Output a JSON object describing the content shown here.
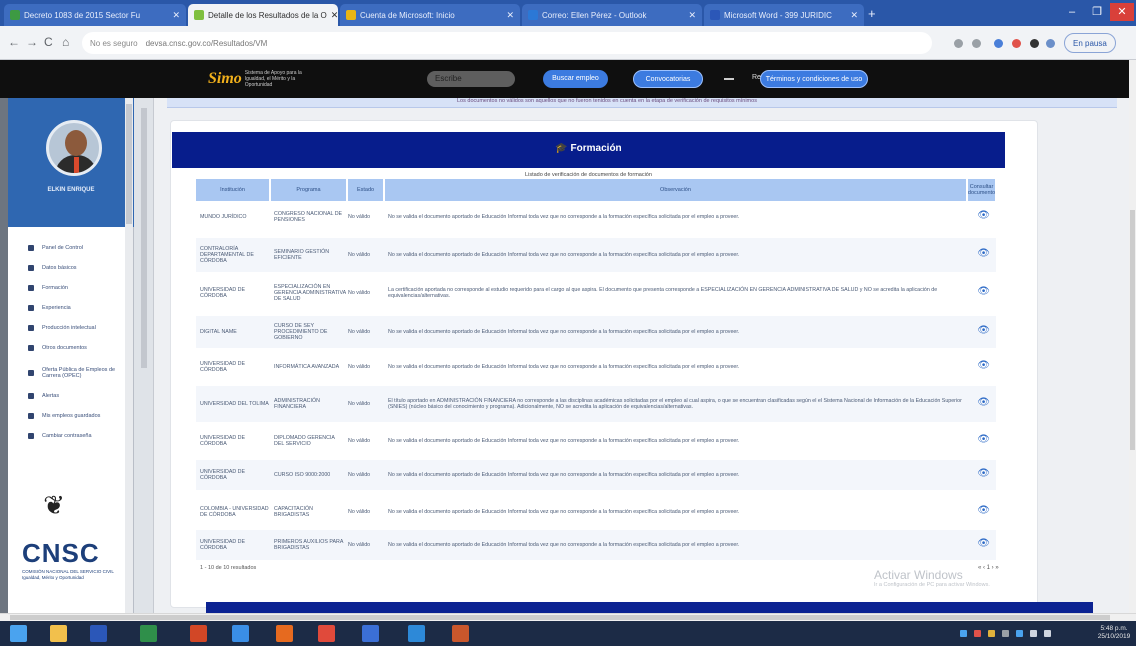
{
  "browser": {
    "tabs": [
      {
        "label": "Decreto 1083 de 2015 Sector Fu",
        "color": "#3d9a43",
        "active": false
      },
      {
        "label": "Detalle de los Resultados de la O",
        "color": "#7fbf3f",
        "active": true
      },
      {
        "label": "Cuenta de Microsoft: Inicio",
        "color": "#e9b616",
        "active": false
      },
      {
        "label": "Correo: Ellen Pérez - Outlook",
        "color": "#2b78d6",
        "active": false
      },
      {
        "label": "Microsoft Word - 399 JURIDIC",
        "color": "#2b57b8",
        "active": false
      }
    ],
    "new_tab": "+",
    "window_controls": {
      "minimize": "–",
      "maximize": "❐",
      "close": "✕"
    },
    "address": {
      "security": "No es seguro",
      "url": "devsa.cnsc.gov.co/Resultados/VM"
    },
    "nav": {
      "back": "←",
      "forward": "→",
      "reload": "C",
      "home": "⌂"
    },
    "profile_button": "En pausa"
  },
  "site_header": {
    "logo_text": "Simo",
    "logo_sub": "Sistema de Apoyo para la Igualdad, el Mérito y la Oportunidad",
    "search_placeholder": "Escribe",
    "buttons": [
      {
        "label": "Buscar empleo"
      },
      {
        "label": "Convocatorias"
      },
      {
        "label": "Términos y condiciones de uso"
      }
    ],
    "label": "Redes"
  },
  "sidebar": {
    "username": "ELKIN ENRIQUE",
    "items": [
      {
        "label": "Panel de Control",
        "icon": "grid-icon"
      },
      {
        "label": "Datos básicos",
        "icon": "user-icon"
      },
      {
        "label": "Formación",
        "icon": "graduation-icon"
      },
      {
        "label": "Experiencia",
        "icon": "briefcase-icon"
      },
      {
        "label": "Producción intelectual",
        "icon": "book-icon"
      },
      {
        "label": "Otros documentos",
        "icon": "file-icon"
      },
      {
        "label": "Oferta Pública de Empleos de Carrera (OPEC)",
        "icon": "globe-icon"
      },
      {
        "label": "Alertas",
        "icon": "bell-icon"
      },
      {
        "label": "Mis empleos guardados",
        "icon": "bookmark-icon"
      },
      {
        "label": "Cambiar contraseña",
        "icon": "key-icon"
      }
    ],
    "org_logo": "CNSC",
    "org_name": "COMISIÓN NACIONAL DEL SERVICIO CIVIL",
    "org_tagline": "Igualdad, Mérito y Oportunidad"
  },
  "main": {
    "top_note": "Los documentos no válidos son aquellos que no fueron tenidos en cuenta en la etapa de verificación de requisitos mínimos",
    "card_title": "Formación",
    "subtitle": "Listado de verificación de documentos de formación",
    "columns": [
      "Institución",
      "Programa",
      "Estado",
      "Observación",
      "Consultar documento"
    ],
    "rows": [
      {
        "institucion": "MUNDO JURÍDICO",
        "programa": "CONGRESO NACIONAL DE PENSIONES",
        "estado": "No válido",
        "observacion": "No se valida el documento aportado de Educación Informal toda vez que no corresponde a la formación específica solicitada por el empleo a proveer."
      },
      {
        "institucion": "CONTRALORÍA DEPARTAMENTAL DE CÓRDOBA",
        "programa": "SEMINARIO GESTIÓN EFICIENTE",
        "estado": "No válido",
        "observacion": "No se valida el documento aportado de Educación Informal toda vez que no corresponde a la formación específica solicitada por el empleo a proveer."
      },
      {
        "institucion": "UNIVERSIDAD DE CÓRDOBA",
        "programa": "ESPECIALIZACIÓN EN GERENCIA ADMINISTRATIVA DE SALUD",
        "estado": "No válido",
        "observacion": "La certificación aportada no corresponde al estudio requerido para el cargo al que aspira. El documento que presenta corresponde a ESPECIALIZACIÓN EN GERENCIA ADMINISTRATIVA DE SALUD y NO se acredita la aplicación de equivalencias/alternativas."
      },
      {
        "institucion": "DIGITAL NAME",
        "programa": "CURSO DE SEY PROCEDIMIENTO DE GOBIERNO",
        "estado": "No válido",
        "observacion": "No se valida el documento aportado de Educación Informal toda vez que no corresponde a la formación específica solicitada por el empleo a proveer."
      },
      {
        "institucion": "UNIVERSIDAD DE CÓRDOBA",
        "programa": "INFORMÁTICA AVANZADA",
        "estado": "No válido",
        "observacion": "No se valida el documento aportado de Educación Informal toda vez que no corresponde a la formación específica solicitada por el empleo a proveer."
      },
      {
        "institucion": "UNIVERSIDAD DEL TOLIMA",
        "programa": "ADMINISTRACIÓN FINANCIERA",
        "estado": "No válido",
        "observacion": "El título aportado en ADMINISTRACIÓN FINANCIERA no corresponde a las disciplinas académicas solicitadas por el empleo al cual aspira, o que se encuentran clasificadas según el el Sistema Nacional de Información de la Educación Superior (SNIES) (núcleo básico del conocimiento y programa). Adicionalmente, NO se acredita la aplicación de equivalencias/alternativas."
      },
      {
        "institucion": "UNIVERSIDAD DE CÓRDOBA",
        "programa": "DIPLOMADO GERENCIA DEL SERVICIO",
        "estado": "No válido",
        "observacion": "No se valida el documento aportado de Educación Informal toda vez que no corresponde a la formación específica solicitada por el empleo a proveer."
      },
      {
        "institucion": "UNIVERSIDAD DE CÓRDOBA",
        "programa": "CURSO ISO 9000:2000",
        "estado": "No válido",
        "observacion": "No se valida el documento aportado de Educación Informal toda vez que no corresponde a la formación específica solicitada por el empleo a proveer."
      },
      {
        "institucion": "COLOMBIA - UNIVERSIDAD DE CÓRDOBA",
        "programa": "CAPACITACIÓN BRIGADISTAS",
        "estado": "No válido",
        "observacion": "No se valida el documento aportado de Educación Informal toda vez que no corresponde a la formación específica solicitada por el empleo a proveer."
      },
      {
        "institucion": "UNIVERSIDAD DE CÓRDOBA",
        "programa": "PRIMEROS AUXILIOS PARA BRIGADISTAS",
        "estado": "No válido",
        "observacion": "No se valida el documento aportado de Educación Informal toda vez que no corresponde a la formación específica solicitada por el empleo a proveer."
      }
    ],
    "results_text": "1 - 10 de 10 resultados",
    "pager": "« ‹ 1 › »"
  },
  "watermark": {
    "line1": "Activar Windows",
    "line2": "Ir a Configuración de PC para activar Windows."
  },
  "taskbar": {
    "clock_time": "5:48 p.m.",
    "clock_date": "25/10/2019"
  }
}
